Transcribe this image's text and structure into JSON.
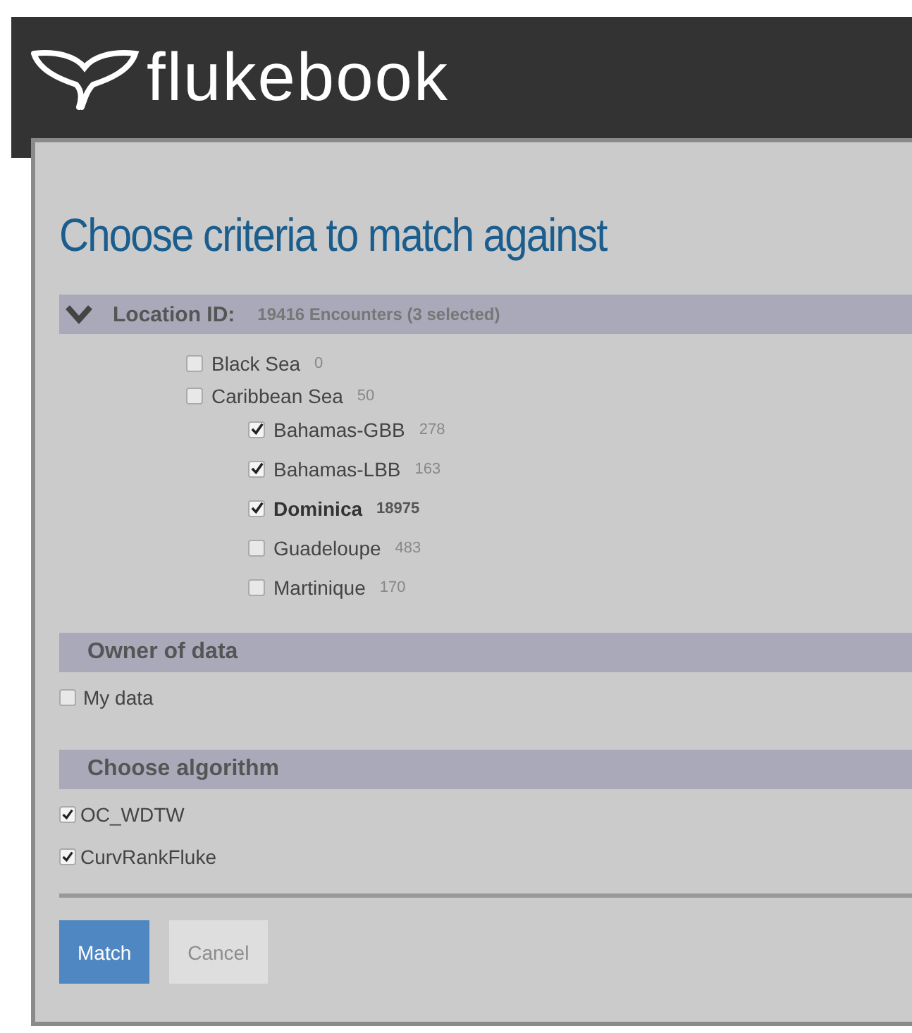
{
  "header": {
    "logo_text": "flukebook"
  },
  "dialog": {
    "title": "Choose criteria to match against",
    "location": {
      "label": "Location ID:",
      "summary": "19416 Encounters (3 selected)",
      "expanded": true,
      "items": [
        {
          "name": "Black Sea",
          "count": "0",
          "checked": false,
          "bold": false
        },
        {
          "name": "Caribbean Sea",
          "count": "50",
          "checked": false,
          "bold": false,
          "children": [
            {
              "name": "Bahamas-GBB",
              "count": "278",
              "checked": true,
              "bold": false
            },
            {
              "name": "Bahamas-LBB",
              "count": "163",
              "checked": true,
              "bold": false
            },
            {
              "name": "Dominica",
              "count": "18975",
              "checked": true,
              "bold": true
            },
            {
              "name": "Guadeloupe",
              "count": "483",
              "checked": false,
              "bold": false
            },
            {
              "name": "Martinique",
              "count": "170",
              "checked": false,
              "bold": false
            }
          ]
        }
      ]
    },
    "owner": {
      "label": "Owner of data",
      "options": [
        {
          "label": "My data",
          "checked": false
        }
      ]
    },
    "algorithm": {
      "label": "Choose algorithm",
      "options": [
        {
          "label": "OC_WDTW",
          "checked": true
        },
        {
          "label": "CurvRankFluke",
          "checked": true
        }
      ]
    },
    "buttons": [
      {
        "label": "Match",
        "disabled": false
      },
      {
        "label": "Cancel",
        "disabled": true
      }
    ]
  }
}
